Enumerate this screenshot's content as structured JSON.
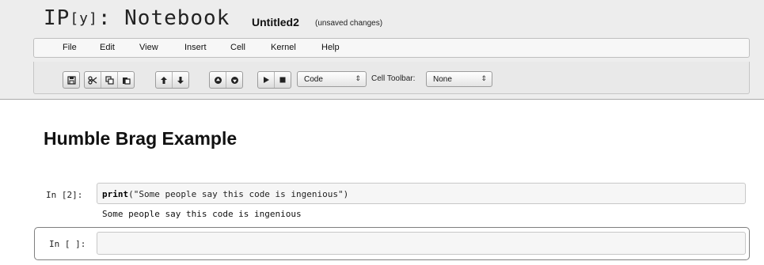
{
  "header": {
    "logo_prefix": "IP",
    "logo_y": "[y]",
    "logo_suffix": ": Notebook",
    "notebook_name": "Untitled2",
    "save_status": "(unsaved changes)"
  },
  "menu": {
    "items": [
      "File",
      "Edit",
      "View",
      "Insert",
      "Cell",
      "Kernel",
      "Help"
    ]
  },
  "toolbar": {
    "icons": [
      "save-icon",
      "cut-icon",
      "copy-icon",
      "paste-icon",
      "arrow-up-icon",
      "arrow-down-icon",
      "run-above-icon",
      "run-below-icon",
      "play-icon",
      "stop-icon"
    ],
    "cell_type": "Code",
    "cell_toolbar_label": "Cell Toolbar:",
    "cell_toolbar_value": "None"
  },
  "notebook": {
    "heading": "Humble Brag Example",
    "cells": [
      {
        "prompt": "In [2]:",
        "code_keyword": "print",
        "code_rest": "(\"Some people say this code is ingenious\")",
        "output": "Some people say this code is ingenious"
      },
      {
        "prompt": "In [ ]:",
        "code": ""
      }
    ]
  }
}
